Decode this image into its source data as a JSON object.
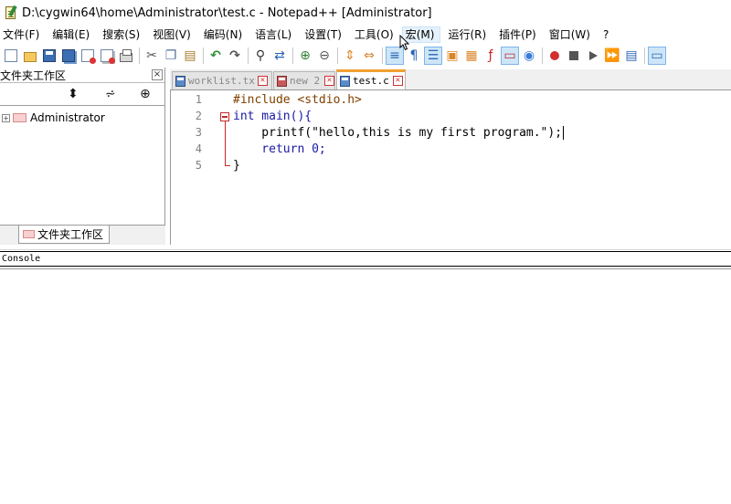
{
  "window": {
    "title": "D:\\cygwin64\\home\\Administrator\\test.c - Notepad++ [Administrator]"
  },
  "menu": {
    "items": [
      {
        "label": "文件(F)"
      },
      {
        "label": "编辑(E)"
      },
      {
        "label": "搜索(S)"
      },
      {
        "label": "视图(V)"
      },
      {
        "label": "编码(N)"
      },
      {
        "label": "语言(L)"
      },
      {
        "label": "设置(T)"
      },
      {
        "label": "工具(O)"
      },
      {
        "label": "宏(M)"
      },
      {
        "label": "运行(R)"
      },
      {
        "label": "插件(P)"
      },
      {
        "label": "窗口(W)"
      },
      {
        "label": "?"
      }
    ],
    "active": "宏(M)"
  },
  "toolbar": {
    "icons": [
      "new-file-icon",
      "open-file-icon",
      "save-icon",
      "save-all-icon",
      "close-icon",
      "close-all-icon",
      "print-icon",
      "cut-icon",
      "copy-icon",
      "paste-icon",
      "undo-icon",
      "redo-icon",
      "find-icon",
      "replace-icon",
      "zoom-in-icon",
      "zoom-out-icon",
      "sync-vertical-icon",
      "sync-horizontal-icon",
      "word-wrap-icon",
      "show-all-chars-icon",
      "indent-guide-icon",
      "user-language-icon",
      "doc-map-icon",
      "function-list-icon",
      "folder-workspace-icon",
      "monitoring-icon",
      "record-macro-icon",
      "stop-record-icon",
      "play-macro-icon",
      "run-macro-multiple-icon",
      "save-macro-icon",
      "console-icon"
    ]
  },
  "left_panel": {
    "title": "文件夹工作区",
    "close_label": "×",
    "tree": [
      {
        "label": "Administrator",
        "expander": "+"
      }
    ],
    "bottom_tab": "文件夹工作区"
  },
  "tabs": [
    {
      "label": "worklist.txt",
      "active": false
    },
    {
      "label": "new 2",
      "active": false
    },
    {
      "label": "test.c",
      "active": true
    }
  ],
  "editor": {
    "line_numbers": [
      "1",
      "2",
      "3",
      "4",
      "5"
    ],
    "lines": [
      "#include <stdio.h>",
      "int main(){",
      "    printf(\"hello,this is my first program.\");",
      "    return 0;",
      "}"
    ]
  },
  "console": {
    "title": "Console"
  },
  "colors": {
    "keyword": "#1a1aa6",
    "preprocessor": "#804000",
    "string": "#808080",
    "number": "#ff8000",
    "fold_marker": "#c62828",
    "active_tab_accent": "#f0a030"
  }
}
